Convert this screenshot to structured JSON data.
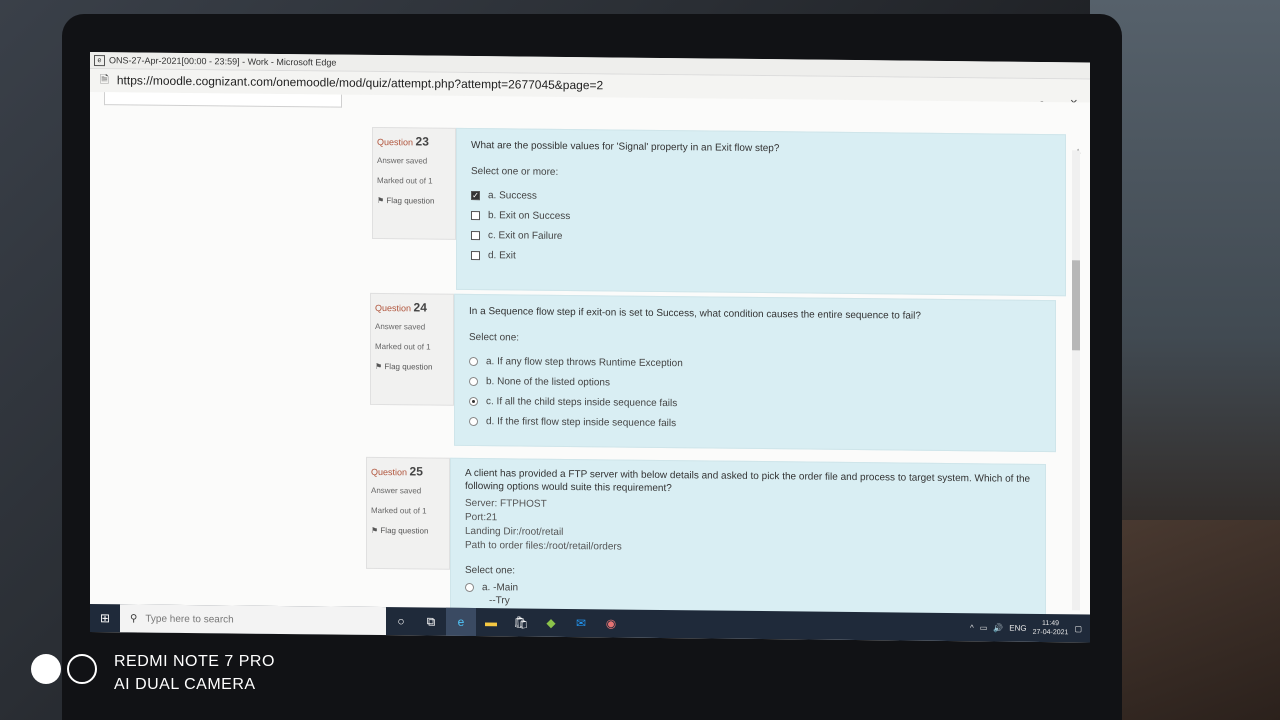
{
  "window": {
    "title": "ONS-27-Apr-2021[00:00 - 23:59] - Work - Microsoft Edge",
    "url": "https://moodle.cognizant.com/onemoodle/mod/quiz/attempt.php?attempt=2677045&page=2",
    "controls": [
      "–",
      "▫",
      "✕"
    ]
  },
  "questions": [
    {
      "number_label": "Question",
      "number": "23",
      "status": "Answer saved",
      "marks": "Marked out of 1",
      "flag": "Flag question",
      "text": "What are the possible values for 'Signal' property in an Exit flow step?",
      "prompt": "Select one or more:",
      "type": "checkbox",
      "options": [
        {
          "label": "a. Success",
          "checked": true
        },
        {
          "label": "b. Exit on Success",
          "checked": false
        },
        {
          "label": "c. Exit on Failure",
          "checked": false
        },
        {
          "label": "d. Exit",
          "checked": false
        }
      ]
    },
    {
      "number_label": "Question",
      "number": "24",
      "status": "Answer saved",
      "marks": "Marked out of 1",
      "flag": "Flag question",
      "text": "In a Sequence flow step if exit-on is set to Success, what condition causes the entire sequence to fail?",
      "prompt": "Select one:",
      "type": "radio",
      "options": [
        {
          "label": "a. If any flow step throws Runtime Exception",
          "checked": false
        },
        {
          "label": "b. None of the listed options",
          "checked": false
        },
        {
          "label": "c. If all the child steps inside sequence fails",
          "checked": true
        },
        {
          "label": "d. If the first flow step inside sequence fails",
          "checked": false
        }
      ]
    },
    {
      "number_label": "Question",
      "number": "25",
      "status": "Answer saved",
      "marks": "Marked out of 1",
      "flag": "Flag question",
      "text": "A client has provided a FTP server with below details and asked to pick the order file and process to target system. Which of the following options would suite this requirement?",
      "details": [
        "Server: FTPHOST",
        "Port:21",
        "Landing Dir:/root/retail",
        "Path to order files:/root/retail/orders"
      ],
      "prompt": "Select one:",
      "options": [
        {
          "label": "a. -Main",
          "checked": false
        },
        {
          "label": "--Try",
          "checked": false
        }
      ]
    }
  ],
  "taskbar": {
    "search_placeholder": "Type here to search",
    "tray_lang": "ENG",
    "time": "11:49",
    "date": "27-04-2021"
  },
  "camera_watermark": {
    "line1": "REDMI NOTE 7 PRO",
    "line2": "AI DUAL CAMERA"
  }
}
